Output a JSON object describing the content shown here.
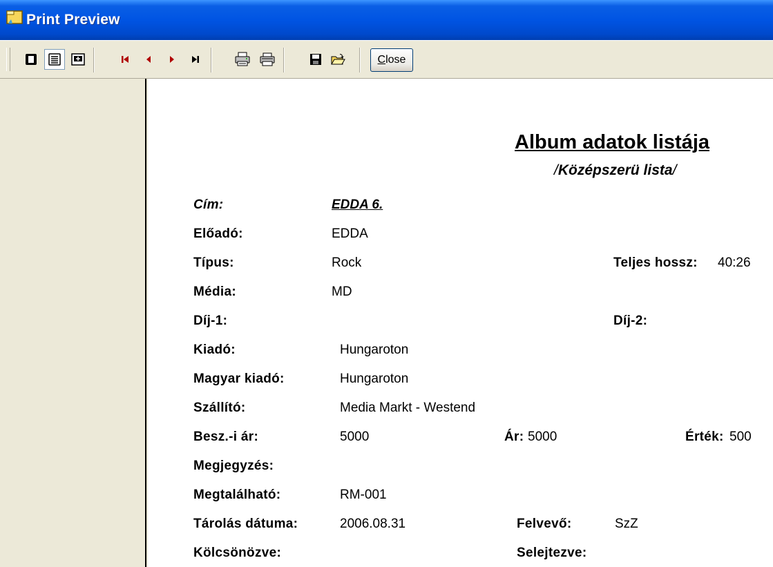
{
  "window": {
    "title": "Print Preview"
  },
  "toolbar": {
    "icons": [
      "one-page-icon",
      "two-page-icon",
      "fit-page-icon",
      "first-page-icon",
      "prev-page-icon",
      "next-page-icon",
      "last-page-icon",
      "print-setup-icon",
      "print-icon",
      "save-icon",
      "open-icon"
    ],
    "close_accel": "C",
    "close_rest": "lose"
  },
  "report": {
    "title": "Album adatok listája",
    "subtitle_open": "/",
    "subtitle_text": "Középszerü lista",
    "subtitle_close": "/",
    "fields": {
      "cim_label": "Cím:",
      "cim_value": "EDDA 6.",
      "eloado_label": "Előadó:",
      "eloado_value": "EDDA",
      "tipus_label": "Típus:",
      "tipus_value": "Rock",
      "teljes_label": "Teljes hossz:",
      "teljes_value": "40:26",
      "media_label": "Média:",
      "media_value": "MD",
      "dij1_label": "Díj-1:",
      "dij2_label": "Díj-2:",
      "kiado_label": "Kiadó:",
      "kiado_value": "Hungaroton",
      "magyar_label": "Magyar kiadó:",
      "magyar_value": "Hungaroton",
      "szallito_label": "Szállító:",
      "szallito_value": "Media Markt - Westend",
      "besz_label": "Besz.-i ár:",
      "besz_value": "5000",
      "ar_label": "Ár:",
      "ar_value": "5000",
      "ertek_label": "Érték:",
      "ertek_value": "500",
      "megj_label": "Megjegyzés:",
      "megtal_label": "Megtalálható:",
      "megtal_value": "RM-001",
      "tarolas_label": "Tárolás dátuma:",
      "tarolas_value": "2006.08.31",
      "felvevo_label": "Felvevő:",
      "felvevo_value": "SzZ",
      "kolcson_label": "Kölcsönözve:",
      "selejt_label": "Selejtezve:"
    }
  },
  "colors": {
    "titlebar": "#0054e3",
    "nav_arrow": "#b00000",
    "toolbar_bg": "#ece9d8"
  }
}
